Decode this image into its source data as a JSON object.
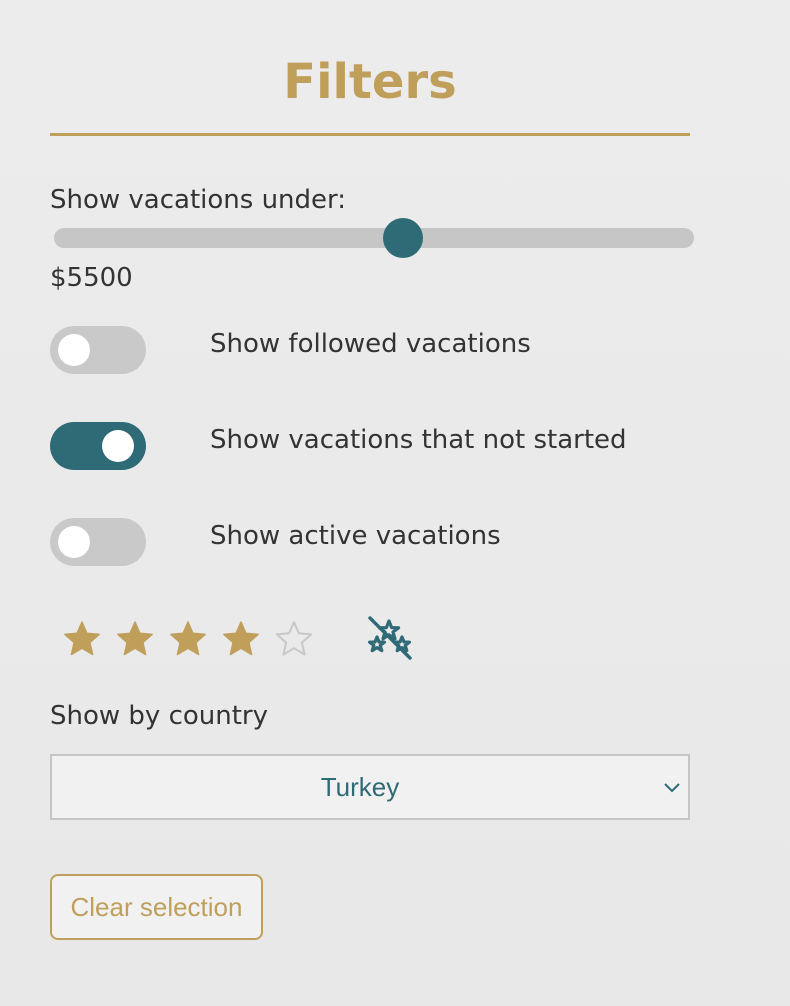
{
  "filters": {
    "title": "Filters",
    "price": {
      "label": "Show vacations under:",
      "value_text": "$5500",
      "fraction": 0.545
    },
    "toggles": [
      {
        "label": "Show followed vacations",
        "on": false
      },
      {
        "label": "Show vacations that not started",
        "on": true
      },
      {
        "label": "Show active vacations",
        "on": false
      }
    ],
    "rating": {
      "value": 4,
      "max": 5,
      "clear_icon": "stars-slash-icon"
    },
    "country": {
      "label": "Show by country",
      "selected": "Turkey"
    },
    "clear_button_label": "Clear selection"
  },
  "colors": {
    "accent_gold": "#c09f5b",
    "accent_teal": "#2e6b77",
    "track_gray": "#c6c6c6",
    "empty_star": "#c8c8c8",
    "text": "#333333",
    "background": "#ececec"
  }
}
